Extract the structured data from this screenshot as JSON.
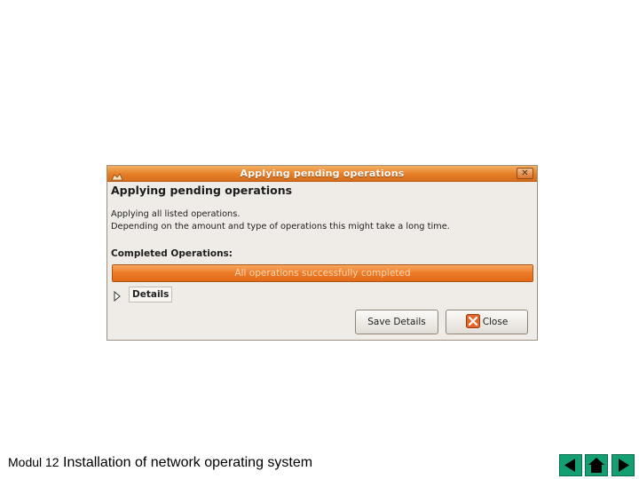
{
  "dialog": {
    "window_title": "Applying pending operations",
    "heading": "Applying pending operations",
    "description_line1": "Applying all listed operations.",
    "description_line2": "Depending on the amount and type of operations this might take a long time.",
    "completed_label": "Completed Operations:",
    "progress": {
      "text": "All operations successfully completed",
      "fraction": 1.0
    },
    "details_label": "Details",
    "buttons": {
      "save_details": "Save Details",
      "close": "Close"
    },
    "icons": {
      "title": "app-icon",
      "title_close": "close-icon",
      "expander": "triangle-right-icon",
      "close_button": "close-x-icon"
    },
    "colors": {
      "titlebar": "#e57f27",
      "progress": "#ec7a26",
      "background": "#efebe7"
    }
  },
  "footer": {
    "prefix": "Modul 12",
    "title": "Installation of network operating system"
  },
  "nav": {
    "icons": [
      "back-arrow-icon",
      "home-icon",
      "forward-arrow-icon"
    ],
    "color": "#149f72"
  }
}
